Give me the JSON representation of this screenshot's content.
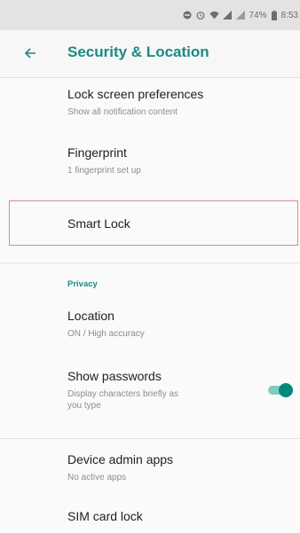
{
  "status_bar": {
    "battery_percent": "74%",
    "time": "8:53"
  },
  "toolbar": {
    "title": "Security & Location"
  },
  "items": [
    {
      "title": "Lock screen preferences",
      "subtitle": "Show all notification content"
    },
    {
      "title": "Fingerprint",
      "subtitle": "1 fingerprint set up"
    },
    {
      "title": "Smart Lock"
    },
    {
      "title": "Location",
      "subtitle": "ON / High accuracy"
    },
    {
      "title": "Show passwords",
      "subtitle_line1": "Display characters briefly as",
      "subtitle_line2": "you type",
      "toggle_on": true
    },
    {
      "title": "Device admin apps",
      "subtitle": "No active apps"
    },
    {
      "title": "SIM card lock"
    }
  ],
  "section": {
    "privacy_header": "Privacy"
  },
  "colors": {
    "accent": "#1a8a83",
    "toggle_thumb": "#00897b",
    "toggle_track": "#80cbc4",
    "highlight_border": "#d98a8a"
  }
}
